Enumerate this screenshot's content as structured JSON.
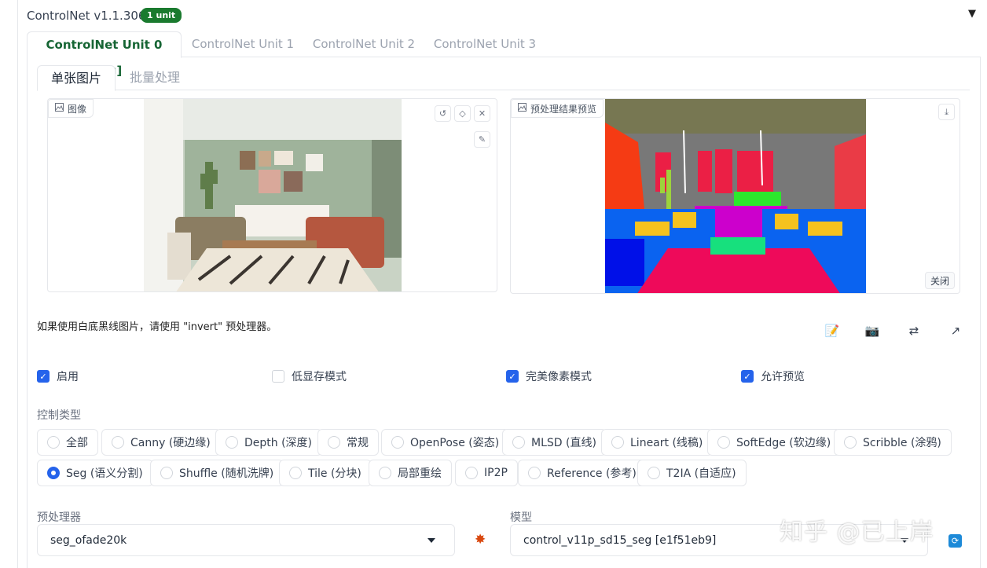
{
  "header": {
    "title": "ControlNet v1.1.306",
    "badge": "1 unit",
    "collapse_glyph": "▼"
  },
  "unit_tabs": [
    "ControlNet Unit 0 [Seg]",
    "ControlNet Unit 1",
    "ControlNet Unit 2",
    "ControlNet Unit 3"
  ],
  "mode_tabs": [
    "单张图片",
    "批量处理"
  ],
  "input_image": {
    "label": "图像",
    "icon": "image-icon",
    "tools": [
      "undo-icon",
      "eraser-icon",
      "close-icon",
      "brush-icon"
    ]
  },
  "preview_image": {
    "label": "预处理结果预览",
    "icon": "image-icon",
    "tools": [
      "download-icon"
    ],
    "close_label": "关闭"
  },
  "hint": "如果使用白底黑线图片，请使用 \"invert\" 预处理器。",
  "action_icons": [
    "edit-icon",
    "camera-icon",
    "swap-icon",
    "send-icon"
  ],
  "checkboxes": [
    {
      "label": "启用",
      "checked": true
    },
    {
      "label": "低显存模式",
      "checked": false
    },
    {
      "label": "完美像素模式",
      "checked": true
    },
    {
      "label": "允许预览",
      "checked": true
    }
  ],
  "control_type": {
    "label": "控制类型",
    "options": [
      "全部",
      "Canny (硬边缘)",
      "Depth (深度)",
      "常规",
      "OpenPose (姿态)",
      "MLSD (直线)",
      "Lineart (线稿)",
      "SoftEdge (软边缘)",
      "Scribble (涂鸦)",
      "Seg (语义分割)",
      "Shuffle (随机洗牌)",
      "Tile (分块)",
      "局部重绘",
      "IP2P",
      "Reference (参考)",
      "T2IA (自适应)"
    ],
    "selected": "Seg (语义分割)"
  },
  "preprocessor": {
    "label": "预处理器",
    "value": "seg_ofade20k",
    "run_icon": "explosion-icon"
  },
  "model": {
    "label": "模型",
    "value": "control_v11p_sd15_seg [e1f51eb9]",
    "refresh_icon": "refresh-icon"
  },
  "watermark": "知乎 @已上岸",
  "colors": {
    "accent_green": "#166534",
    "badge": "#1a7a2e",
    "checkbox_blue": "#2563eb"
  }
}
